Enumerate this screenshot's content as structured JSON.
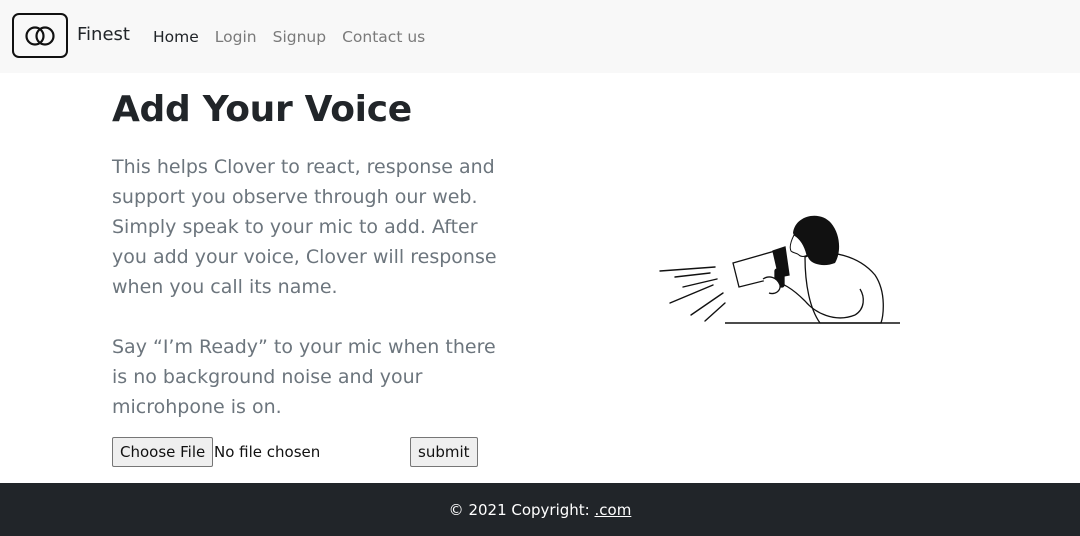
{
  "navbar": {
    "brand": "Finest",
    "logo_icon": "interlocking-rings-icon",
    "links": [
      {
        "label": "Home",
        "active": true
      },
      {
        "label": "Login",
        "active": false
      },
      {
        "label": "Signup",
        "active": false
      },
      {
        "label": "Contact us",
        "active": false
      }
    ]
  },
  "main": {
    "title": "Add Your Voice",
    "paragraph1": "This helps Clover to react, response and support you observe through our web. Simply speak to your mic to add. After you add your voice, Clover will response when you call its name.",
    "paragraph2": "Say “I’m Ready” to your mic when there is no background noise and your microhpone is on.",
    "file_input": {
      "button_label": "Choose File",
      "status": "No file chosen"
    },
    "submit_label": "submit",
    "illustration": "woman-with-megaphone-illustration"
  },
  "footer": {
    "copyright_text": "© 2021 Copyright:",
    "link_text": ".com"
  },
  "colors": {
    "navbar_bg": "#f8f8f8",
    "footer_bg": "#212529",
    "muted_text": "#6c757d"
  }
}
